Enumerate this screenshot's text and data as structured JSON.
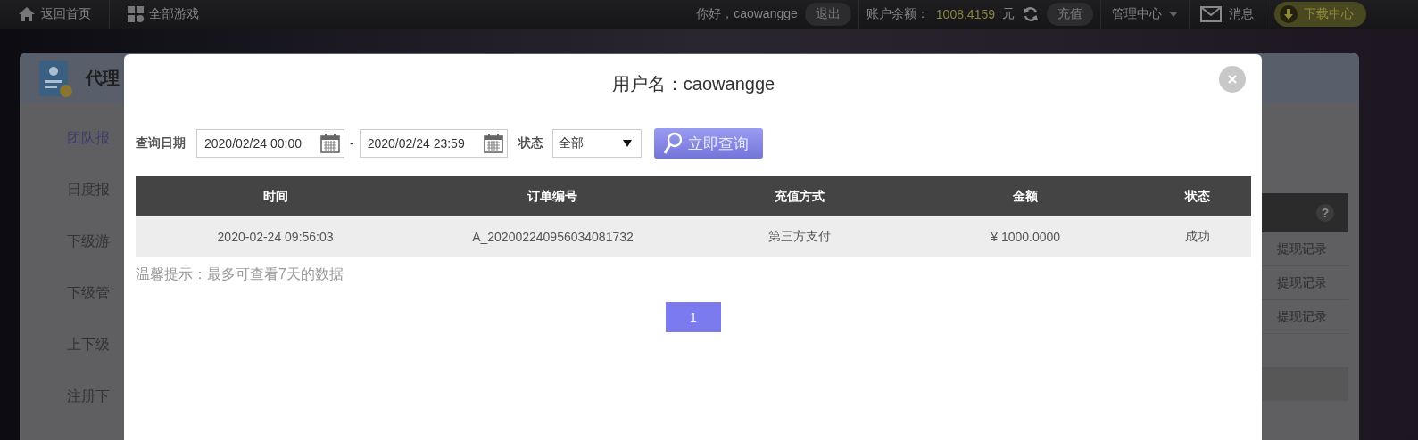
{
  "top_bar": {
    "links": [
      {
        "label": "返回首页"
      },
      {
        "label": "全部游戏"
      }
    ],
    "greeting": "你好，caowangge",
    "logout": "退出",
    "balance_label": "账户余额：",
    "balance": "1008.4159",
    "currency": "元",
    "recharge": "充值",
    "manage": "管理中心",
    "messages": "消息",
    "download": "下载中心"
  },
  "background": {
    "title": "代理",
    "sidebar_items": [
      "团队报",
      "日度报",
      "下级游",
      "下级管",
      "上下级",
      "注册下"
    ],
    "help": "?",
    "table_rows": [
      "提现记录",
      "提现记录",
      "提现记录"
    ]
  },
  "modal": {
    "title": "用户名：caowangge",
    "filters": {
      "date_label": "查询日期",
      "start": "2020/02/24 00:00",
      "separator": "-",
      "end": "2020/02/24 23:59",
      "status_label": "状态",
      "status_value": "全部",
      "search_button": "立即查询"
    },
    "table": {
      "columns": [
        "时间",
        "订单编号",
        "充值方式",
        "金额",
        "状态"
      ],
      "rows": [
        [
          "2020-02-24 09:56:03",
          "A_202002240956034081732",
          "第三方支付",
          "¥ 1000.0000",
          "成功"
        ]
      ]
    },
    "hint": "温馨提示：最多可查看7天的数据",
    "pages": [
      {
        "label": "1",
        "selected": true
      }
    ]
  }
}
